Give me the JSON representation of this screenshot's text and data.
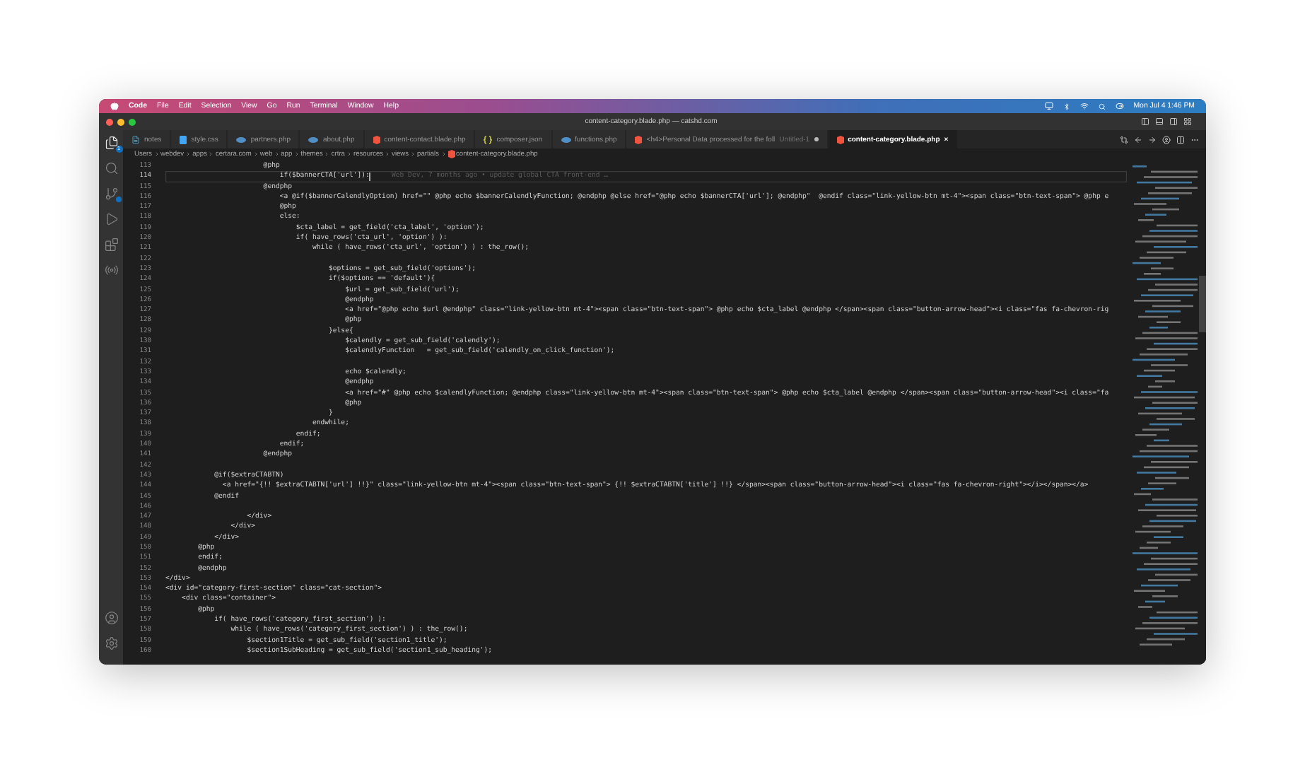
{
  "menu_bar": {
    "app": "Code",
    "items": [
      "File",
      "Edit",
      "Selection",
      "View",
      "Go",
      "Run",
      "Terminal",
      "Window",
      "Help"
    ],
    "clock": "Mon Jul 4  1:46 PM"
  },
  "window": {
    "title": "content-category.blade.php — catshd.com"
  },
  "activity_bar": [
    {
      "kind": "explorer",
      "selected": true,
      "notice": false,
      "badge": "1"
    },
    {
      "kind": "search",
      "selected": false,
      "notice": false
    },
    {
      "kind": "source-control",
      "selected": false,
      "notice": true
    },
    {
      "kind": "run",
      "selected": false,
      "notice": false
    },
    {
      "kind": "extensions",
      "selected": false,
      "notice": false
    },
    {
      "kind": "remote",
      "selected": false,
      "notice": false
    },
    {
      "kind": "account",
      "selected": false,
      "notice": false
    },
    {
      "kind": "settings",
      "selected": false,
      "notice": false
    }
  ],
  "tabs": [
    {
      "label": "notes",
      "kind": "text",
      "selected": false,
      "modified": false
    },
    {
      "label": "style.css",
      "kind": "css",
      "selected": false,
      "modified": false
    },
    {
      "label": "partners.php",
      "kind": "php",
      "selected": false,
      "modified": false
    },
    {
      "label": "about.php",
      "kind": "php",
      "selected": false,
      "modified": false
    },
    {
      "label": "content-contact.blade.php",
      "kind": "blade",
      "selected": false,
      "modified": false
    },
    {
      "label": "composer.json",
      "kind": "json",
      "selected": false,
      "modified": false
    },
    {
      "label": "functions.php",
      "kind": "php",
      "selected": false,
      "modified": false
    },
    {
      "label": "<h4>Personal Data processed for the foll",
      "detail": "Untitled-1",
      "kind": "blade",
      "selected": false,
      "modified": true
    },
    {
      "label": "content-category.blade.php",
      "close": "×",
      "kind": "blade",
      "selected": true,
      "modified": false
    }
  ],
  "breadcrumb": [
    "Users",
    "webdev",
    "apps",
    "certara.com",
    "web",
    "app",
    "themes",
    "crtra",
    "resources",
    "views",
    "partials",
    "content-category.blade.php"
  ],
  "editor": {
    "lines": [
      {
        "number": "113",
        "text": "                        @php",
        "current": false
      },
      {
        "number": "114",
        "text": "                            if($bannerCTA['url']):",
        "current": true,
        "blame": "Web Dev, 7 months ago • update global CTA front-end …"
      },
      {
        "number": "115",
        "text": "                        @endphp",
        "current": false
      },
      {
        "number": "116",
        "text": "                            <a @if($bannerCalendlyOption) href=\"\" @php echo $bannerCalendlyFunction; @endphp @else href=\"@php echo $bannerCTA['url']; @endphp\"  @endif class=\"link-yellow-btn mt-4\"><span class=\"btn-text-span\"> @php e",
        "current": false
      },
      {
        "number": "117",
        "text": "                            @php",
        "current": false
      },
      {
        "number": "118",
        "text": "                            else:",
        "current": false
      },
      {
        "number": "119",
        "text": "                                $cta_label = get_field('cta_label', 'option');",
        "current": false
      },
      {
        "number": "120",
        "text": "                                if( have_rows('cta_url', 'option') ):",
        "current": false
      },
      {
        "number": "121",
        "text": "                                    while ( have_rows('cta_url', 'option') ) : the_row();",
        "current": false
      },
      {
        "number": "122",
        "current": false
      },
      {
        "number": "123",
        "text": "                                        $options = get_sub_field('options');",
        "current": false
      },
      {
        "number": "124",
        "text": "                                        if($options == 'default'){",
        "current": false
      },
      {
        "number": "125",
        "text": "                                            $url = get_sub_field('url');",
        "current": false
      },
      {
        "number": "126",
        "text": "                                            @endphp",
        "current": false
      },
      {
        "number": "127",
        "text": "                                            <a href=\"@php echo $url @endphp\" class=\"link-yellow-btn mt-4\"><span class=\"btn-text-span\"> @php echo $cta_label @endphp </span><span class=\"button-arrow-head\"><i class=\"fas fa-chevron-rig",
        "current": false
      },
      {
        "number": "128",
        "text": "                                            @php",
        "current": false
      },
      {
        "number": "129",
        "text": "                                        }else{",
        "current": false
      },
      {
        "number": "130",
        "text": "                                            $calendly = get_sub_field('calendly');",
        "current": false
      },
      {
        "number": "131",
        "text": "                                            $calendlyFunction   = get_sub_field('calendly_on_click_function');",
        "current": false
      },
      {
        "number": "132",
        "current": false
      },
      {
        "number": "133",
        "text": "                                            echo $calendly;",
        "current": false
      },
      {
        "number": "134",
        "text": "                                            @endphp",
        "current": false
      },
      {
        "number": "135",
        "text": "                                            <a href=\"#\" @php echo $calendlyFunction; @endphp class=\"link-yellow-btn mt-4\"><span class=\"btn-text-span\"> @php echo $cta_label @endphp </span><span class=\"button-arrow-head\"><i class=\"fa",
        "current": false
      },
      {
        "number": "136",
        "text": "                                            @php",
        "current": false
      },
      {
        "number": "137",
        "text": "                                        }",
        "current": false
      },
      {
        "number": "138",
        "text": "                                    endwhile;",
        "current": false
      },
      {
        "number": "139",
        "text": "                                endif;",
        "current": false
      },
      {
        "number": "140",
        "text": "                            endif;",
        "current": false
      },
      {
        "number": "141",
        "text": "                        @endphp",
        "current": false
      },
      {
        "number": "142",
        "current": false
      },
      {
        "number": "143",
        "text": "            @if($extraCTABTN)",
        "current": false
      },
      {
        "number": "144",
        "text": "              <a href=\"{!! $extraCTABTN['url'] !!}\" class=\"link-yellow-btn mt-4\"><span class=\"btn-text-span\"> {!! $extraCTABTN['title'] !!} </span><span class=\"button-arrow-head\"><i class=\"fas fa-chevron-right\"></i></span></a>",
        "current": false
      },
      {
        "number": "145",
        "text": "            @endif",
        "current": false
      },
      {
        "number": "146",
        "current": false
      },
      {
        "number": "147",
        "text": "                    </div>",
        "current": false
      },
      {
        "number": "148",
        "text": "                </div>",
        "current": false
      },
      {
        "number": "149",
        "text": "            </div>",
        "current": false
      },
      {
        "number": "150",
        "text": "        @php",
        "current": false
      },
      {
        "number": "151",
        "text": "        endif;",
        "current": false
      },
      {
        "number": "152",
        "text": "        @endphp",
        "current": false
      },
      {
        "number": "153",
        "text": "</div>",
        "current": false
      },
      {
        "number": "154",
        "text": "<div id=\"category-first-section\" class=\"cat-section\">",
        "current": false
      },
      {
        "number": "155",
        "text": "    <div class=\"container\">",
        "current": false
      },
      {
        "number": "156",
        "text": "        @php",
        "current": false
      },
      {
        "number": "157",
        "text": "            if( have_rows('category_first_section') ):",
        "current": false
      },
      {
        "number": "158",
        "text": "                while ( have_rows('category_first_section') ) : the_row();",
        "current": false
      },
      {
        "number": "159",
        "text": "                    $section1Title = get_sub_field('section1_title');",
        "current": false
      },
      {
        "number": "160",
        "text": "                    $section1SubHeading = get_sub_field('section1_sub_heading');",
        "current": false
      }
    ]
  }
}
